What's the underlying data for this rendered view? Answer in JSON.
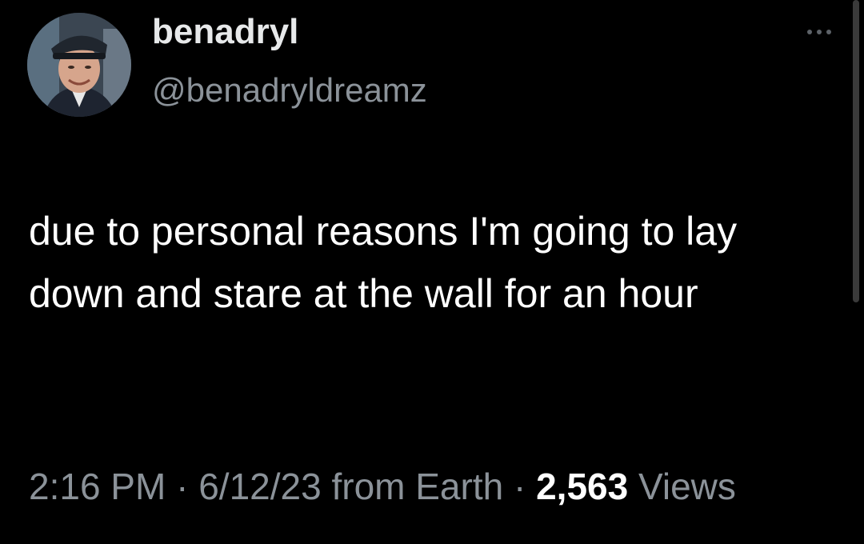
{
  "user": {
    "display_name": "benadryl",
    "handle": "@benadryldreamz"
  },
  "tweet": {
    "text": "due to personal reasons I'm going to lay down and stare at the wall for an hour",
    "time": "2:16 PM",
    "date": "6/12/23",
    "source": "from Earth",
    "separator": "·",
    "views_count": "2,563",
    "views_label": "Views"
  },
  "icons": {
    "more": "more-horizontal-icon",
    "avatar": "avatar-photo"
  },
  "colors": {
    "background": "#000000",
    "primary_text": "#e7e9ea",
    "secondary_text": "#8b9299"
  }
}
